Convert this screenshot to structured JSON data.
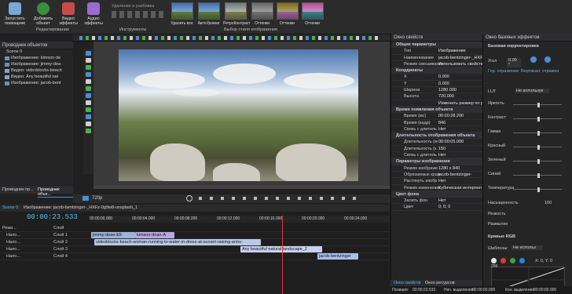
{
  "ribbon": {
    "buttons": [
      {
        "label": "Запустить\nпомощник",
        "icon": "wizard-icon",
        "color": "#7aa7d8"
      },
      {
        "label": "Добавить\nобъект",
        "icon": "add-object-icon",
        "color": "#3c8d40"
      },
      {
        "label": "Видео\nэффекты",
        "icon": "video-effects-icon",
        "color": "#c74b4b"
      },
      {
        "label": "Аудио\nэффекты",
        "icon": "audio-effects-icon",
        "color": "#9a6bd1"
      }
    ],
    "group_edit": "Редактирование",
    "tools_label": "Инструменты",
    "styles_label": "Выбор стиля отображения",
    "tool_items": [
      "Удаление и разбивка"
    ],
    "styles": [
      "Удалить все",
      "АвтоУровни",
      "РетроКонтраст",
      "Оттенки",
      "Оттенки",
      "Оттенки"
    ]
  },
  "objects": {
    "title": "Проводник объектов",
    "scene": "Scene 0",
    "items": [
      "Изображение: kimson-de",
      "Изображение: jimmy-dea",
      "Видео: videoblocks-beach",
      "Видео: Any beautiful nat",
      "Изображение: jacob-bent"
    ],
    "tabs": [
      "Проводник пр...",
      "Проводник объе..."
    ]
  },
  "preview": {
    "quality": "720p",
    "zoom_pct": "45%"
  },
  "timeline": {
    "tabs": [
      "Scene 0",
      "Изображение: jacob-bentzinger-_HXFz-0g9w8-unsplash_1"
    ],
    "time": "00:00:23.533",
    "mode_label": "Режи...",
    "tracks": [
      {
        "name": "Слой",
        "mode": ""
      },
      {
        "name": "Слой 1",
        "mode": "Нало..."
      },
      {
        "name": "Слой 2",
        "mode": "Нало..."
      },
      {
        "name": "Слой 3",
        "mode": "Нало..."
      },
      {
        "name": "Слой 4",
        "mode": "Нало..."
      }
    ],
    "clips": [
      {
        "label": "jimmy-dean-E5",
        "color": "#9db3d9",
        "track": 1
      },
      {
        "label": "kimson-doan-A",
        "color": "#b9a7e0",
        "track": 1
      },
      {
        "label": "videoblocks-beach-woman-running-to-water-in-dress-at-sunset-raising-arms-",
        "color": "#b8c8e6",
        "track": 2
      },
      {
        "label": "Any beautiful natural landscape_2",
        "color": "#c8cff0",
        "track": 3
      },
      {
        "label": "jacob-bentzinger",
        "color": "#a8c0ea",
        "track": 4
      }
    ]
  },
  "props": {
    "title": "Окно свойств",
    "header_cols": [
      "Имя",
      "Значение"
    ],
    "rows": [
      {
        "t": "sec",
        "k": "Общие параметры"
      },
      {
        "k": "Тип",
        "v": "Изображение"
      },
      {
        "k": "Наименование",
        "v": "jacob-bentzinger-_HXFz"
      },
      {
        "k": "Режим смешивания",
        "v": "Использовать свойства"
      },
      {
        "t": "sec",
        "k": "Координаты"
      },
      {
        "k": "X",
        "v": "0.000"
      },
      {
        "k": "Y",
        "v": "0.000"
      },
      {
        "k": "Ширина",
        "v": "1280.000"
      },
      {
        "k": "Высота",
        "v": "720.000"
      },
      {
        "k": "",
        "v": "Изменить размер по род. объекту"
      },
      {
        "t": "sec",
        "k": "Время появления объекта"
      },
      {
        "k": "Время (мс)",
        "v": "00:00:28.200"
      },
      {
        "k": "Время (кадр)",
        "v": "846"
      },
      {
        "k": "Связь с длитель",
        "v": "Нет"
      },
      {
        "t": "sec",
        "k": "Длительность отображения объекта"
      },
      {
        "k": "Длительность (м",
        "v": "00:00:05.000"
      },
      {
        "k": "Длительность (к",
        "v": "150"
      },
      {
        "k": "Связь с длитель",
        "v": "Нет"
      },
      {
        "t": "sec",
        "k": "Параметры изображения"
      },
      {
        "k": "Режим изображе",
        "v": "1280 x 840"
      },
      {
        "k": "Обрезаемые края",
        "v": "jacob-bentzinger-"
      },
      {
        "k": "Растянуть изобр",
        "v": "Нет"
      },
      {
        "k": "Режим изменения",
        "v": "Кубическая интерпол"
      },
      {
        "t": "sec",
        "k": "Цвет фона"
      },
      {
        "k": "Залить фон",
        "v": "Нет"
      },
      {
        "k": "Цвет",
        "v": "0; 0; 0"
      }
    ],
    "tabs": [
      "Окно свойств",
      "Окно ресурсов"
    ]
  },
  "effects": {
    "title": "Окно базовых эффектов",
    "section": "Базовая корректировка",
    "angle_label": "Угол",
    "angle": "0.00 °",
    "reflect_h": "Гор. отражение",
    "reflect_v": "Вертикал. отражен",
    "lut": "LUT",
    "lut_value": "Не используе",
    "sliders": [
      {
        "label": "Яркость",
        "value": 0.5
      },
      {
        "label": "Контраст",
        "value": 0.5
      },
      {
        "label": "Гамма",
        "value": 0.5
      },
      {
        "label": "Красный",
        "value": 0.5
      },
      {
        "label": "Зеленый",
        "value": 0.5
      },
      {
        "label": "Синий",
        "value": 0.5
      },
      {
        "label": "Температура",
        "value": 0.5
      }
    ],
    "saturation_label": "Насыщенность",
    "saturation": "100",
    "extra": [
      "Резкость",
      "Размытие"
    ],
    "curves": "Кривые RGB",
    "templates": "Шаблоны:",
    "templates_value": "Не использ",
    "xy": "X: 0, Y: 0",
    "curve_top": "255",
    "curve_mid": "128",
    "zoom": "52%",
    "colors": [
      "#e8e8e8",
      "#e53935",
      "#43a047",
      "#1e88e5"
    ]
  },
  "status": {
    "position_label": "Позиция:",
    "position": "00:00:23.533",
    "sel_start": "Нач. выделения:",
    "sel_start_v": "00:00:00.000",
    "sel_end": "Кон. выделения:",
    "sel_end_v": "00:00:00.000"
  },
  "ruler": [
    "00:00:00.000",
    "00:00:04.000",
    "00:00:08.000",
    "00:00:12.000",
    "00:00:16.000",
    "00:00:20.000",
    "00:00:24.000",
    "00:00:28.000"
  ]
}
